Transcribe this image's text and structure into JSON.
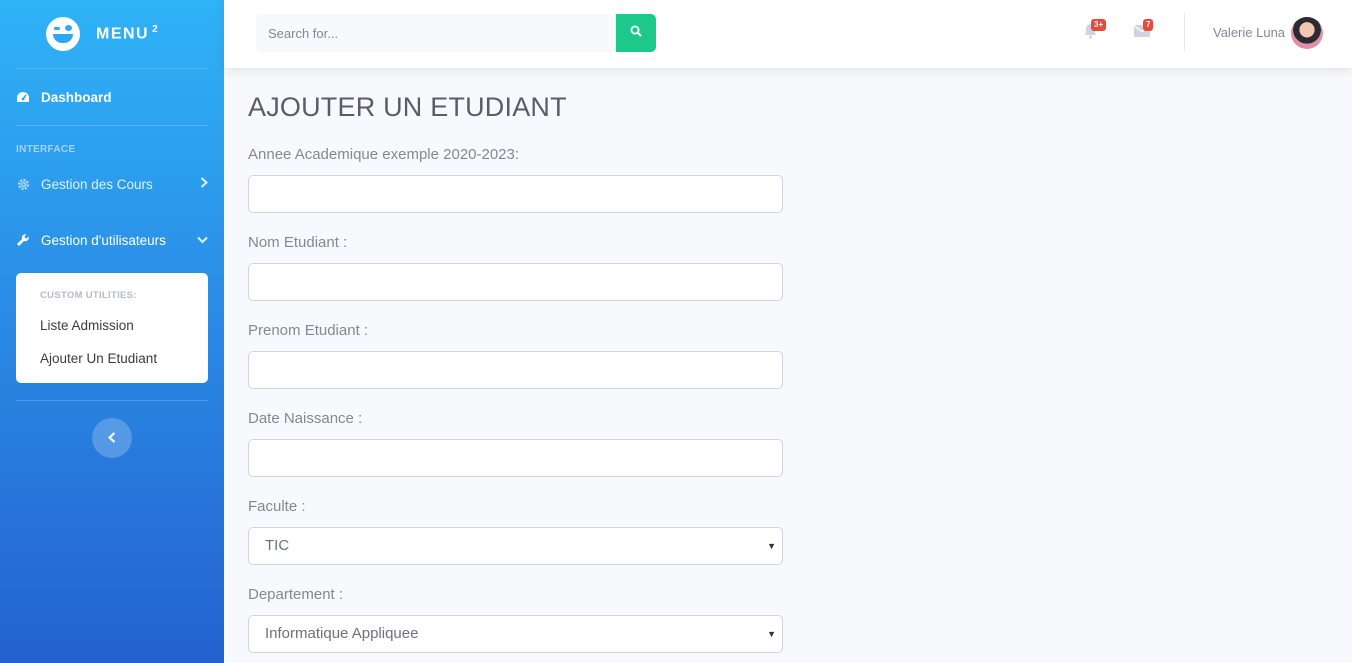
{
  "brand": {
    "name": "MENU",
    "sup": "2"
  },
  "sidebar": {
    "dashboard_label": "Dashboard",
    "section_heading": "INTERFACE",
    "items": [
      {
        "label": "Gestion des Cours",
        "icon": "gear-icon"
      },
      {
        "label": "Gestion d'utilisateurs",
        "icon": "wrench-icon"
      }
    ],
    "submenu": {
      "heading": "CUSTOM UTILITIES:",
      "items": [
        "Liste Admission",
        "Ajouter Un Etudiant"
      ]
    }
  },
  "topbar": {
    "search_placeholder": "Search for...",
    "alerts_badge": "3+",
    "messages_badge": "7",
    "user_name": "Valerie Luna"
  },
  "page": {
    "title": "AJOUTER UN ETUDIANT",
    "fields": [
      {
        "label": "Annee Academique exemple 2020-2023:",
        "value": ""
      },
      {
        "label": "Nom Etudiant :",
        "value": ""
      },
      {
        "label": "Prenom Etudiant :",
        "value": ""
      },
      {
        "label": "Date Naissance :",
        "value": ""
      },
      {
        "label": "Faculte :",
        "selected": "TIC"
      },
      {
        "label": "Departement :",
        "selected": "Informatique Appliquee"
      }
    ]
  },
  "colors": {
    "accent": "#1cc88a",
    "sidebar_top": "#2fb3f7",
    "sidebar_bottom": "#2462cf",
    "badge": "#e74a3b"
  }
}
